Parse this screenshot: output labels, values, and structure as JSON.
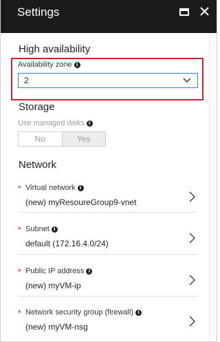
{
  "window": {
    "title": "Settings",
    "maximize_icon": "maximize-icon",
    "close_icon": "close-icon"
  },
  "high_availability": {
    "heading": "High availability",
    "availability_zone": {
      "label": "Availability zone",
      "value": "2",
      "highlight_color": "#c7232f"
    }
  },
  "storage": {
    "heading": "Storage",
    "managed_disks": {
      "label": "Use managed disks",
      "options": [
        "No",
        "Yes"
      ],
      "selected": "Yes"
    }
  },
  "network": {
    "heading": "Network",
    "fields": [
      {
        "label": "Virtual network",
        "required": "*",
        "value": "(new) myResoureGroup9-vnet"
      },
      {
        "label": "Subnet",
        "required": "*",
        "value": "default (172.16.4.0/24)"
      },
      {
        "label": "Public IP address",
        "required": "*",
        "value": "(new) myVM-ip"
      },
      {
        "label": "Network security group (firewall)",
        "required": "*",
        "value": "(new) myVM-nsg"
      }
    ]
  },
  "colors": {
    "titlebar": "#1b1b1b",
    "required": "#c7232f",
    "focus": "#2b7de9"
  }
}
